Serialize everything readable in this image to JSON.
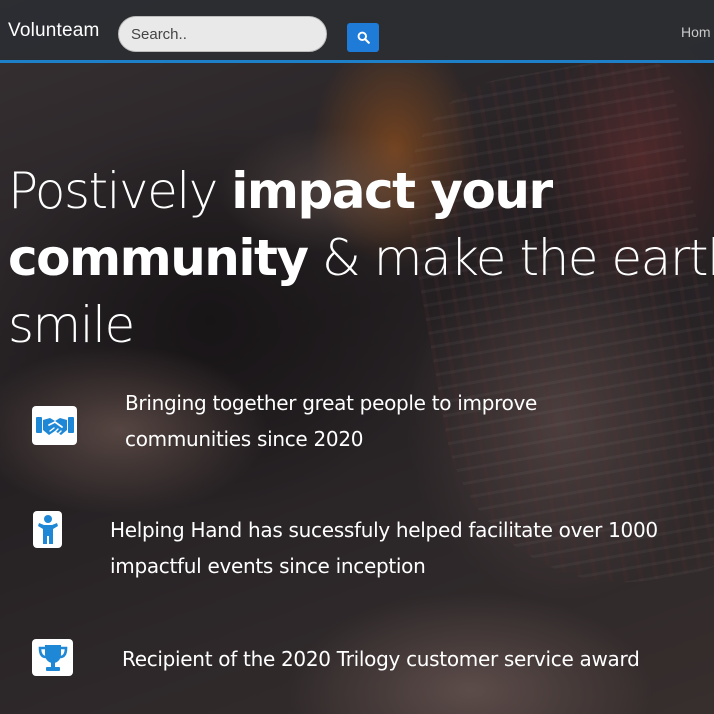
{
  "navbar": {
    "brand": "Volunteam",
    "search": {
      "placeholder": "Search..",
      "value": ""
    },
    "search_button_icon": "search-icon",
    "links": [
      "Hom"
    ]
  },
  "hero": {
    "headline": {
      "part1": "Postively ",
      "bold1": "impact your",
      "bold2": "community",
      "part2": " & make the earth",
      "part3": "smile"
    },
    "features": [
      {
        "icon": "handshake-icon",
        "line1": "Bringing together great people to improve",
        "line2": "communities since 2020"
      },
      {
        "icon": "person-icon",
        "line1": "Helping Hand has sucessfuly helped facilitate over 1000",
        "line2": "impactful events since inception"
      },
      {
        "icon": "trophy-icon",
        "line1": "Recipient of the 2020 Trilogy customer service award"
      }
    ]
  },
  "colors": {
    "accent": "#1e7bd8",
    "navbar_border": "#1d80c8",
    "navbar_bg": "#2b2e32",
    "icon_blue": "#1e88d6"
  }
}
